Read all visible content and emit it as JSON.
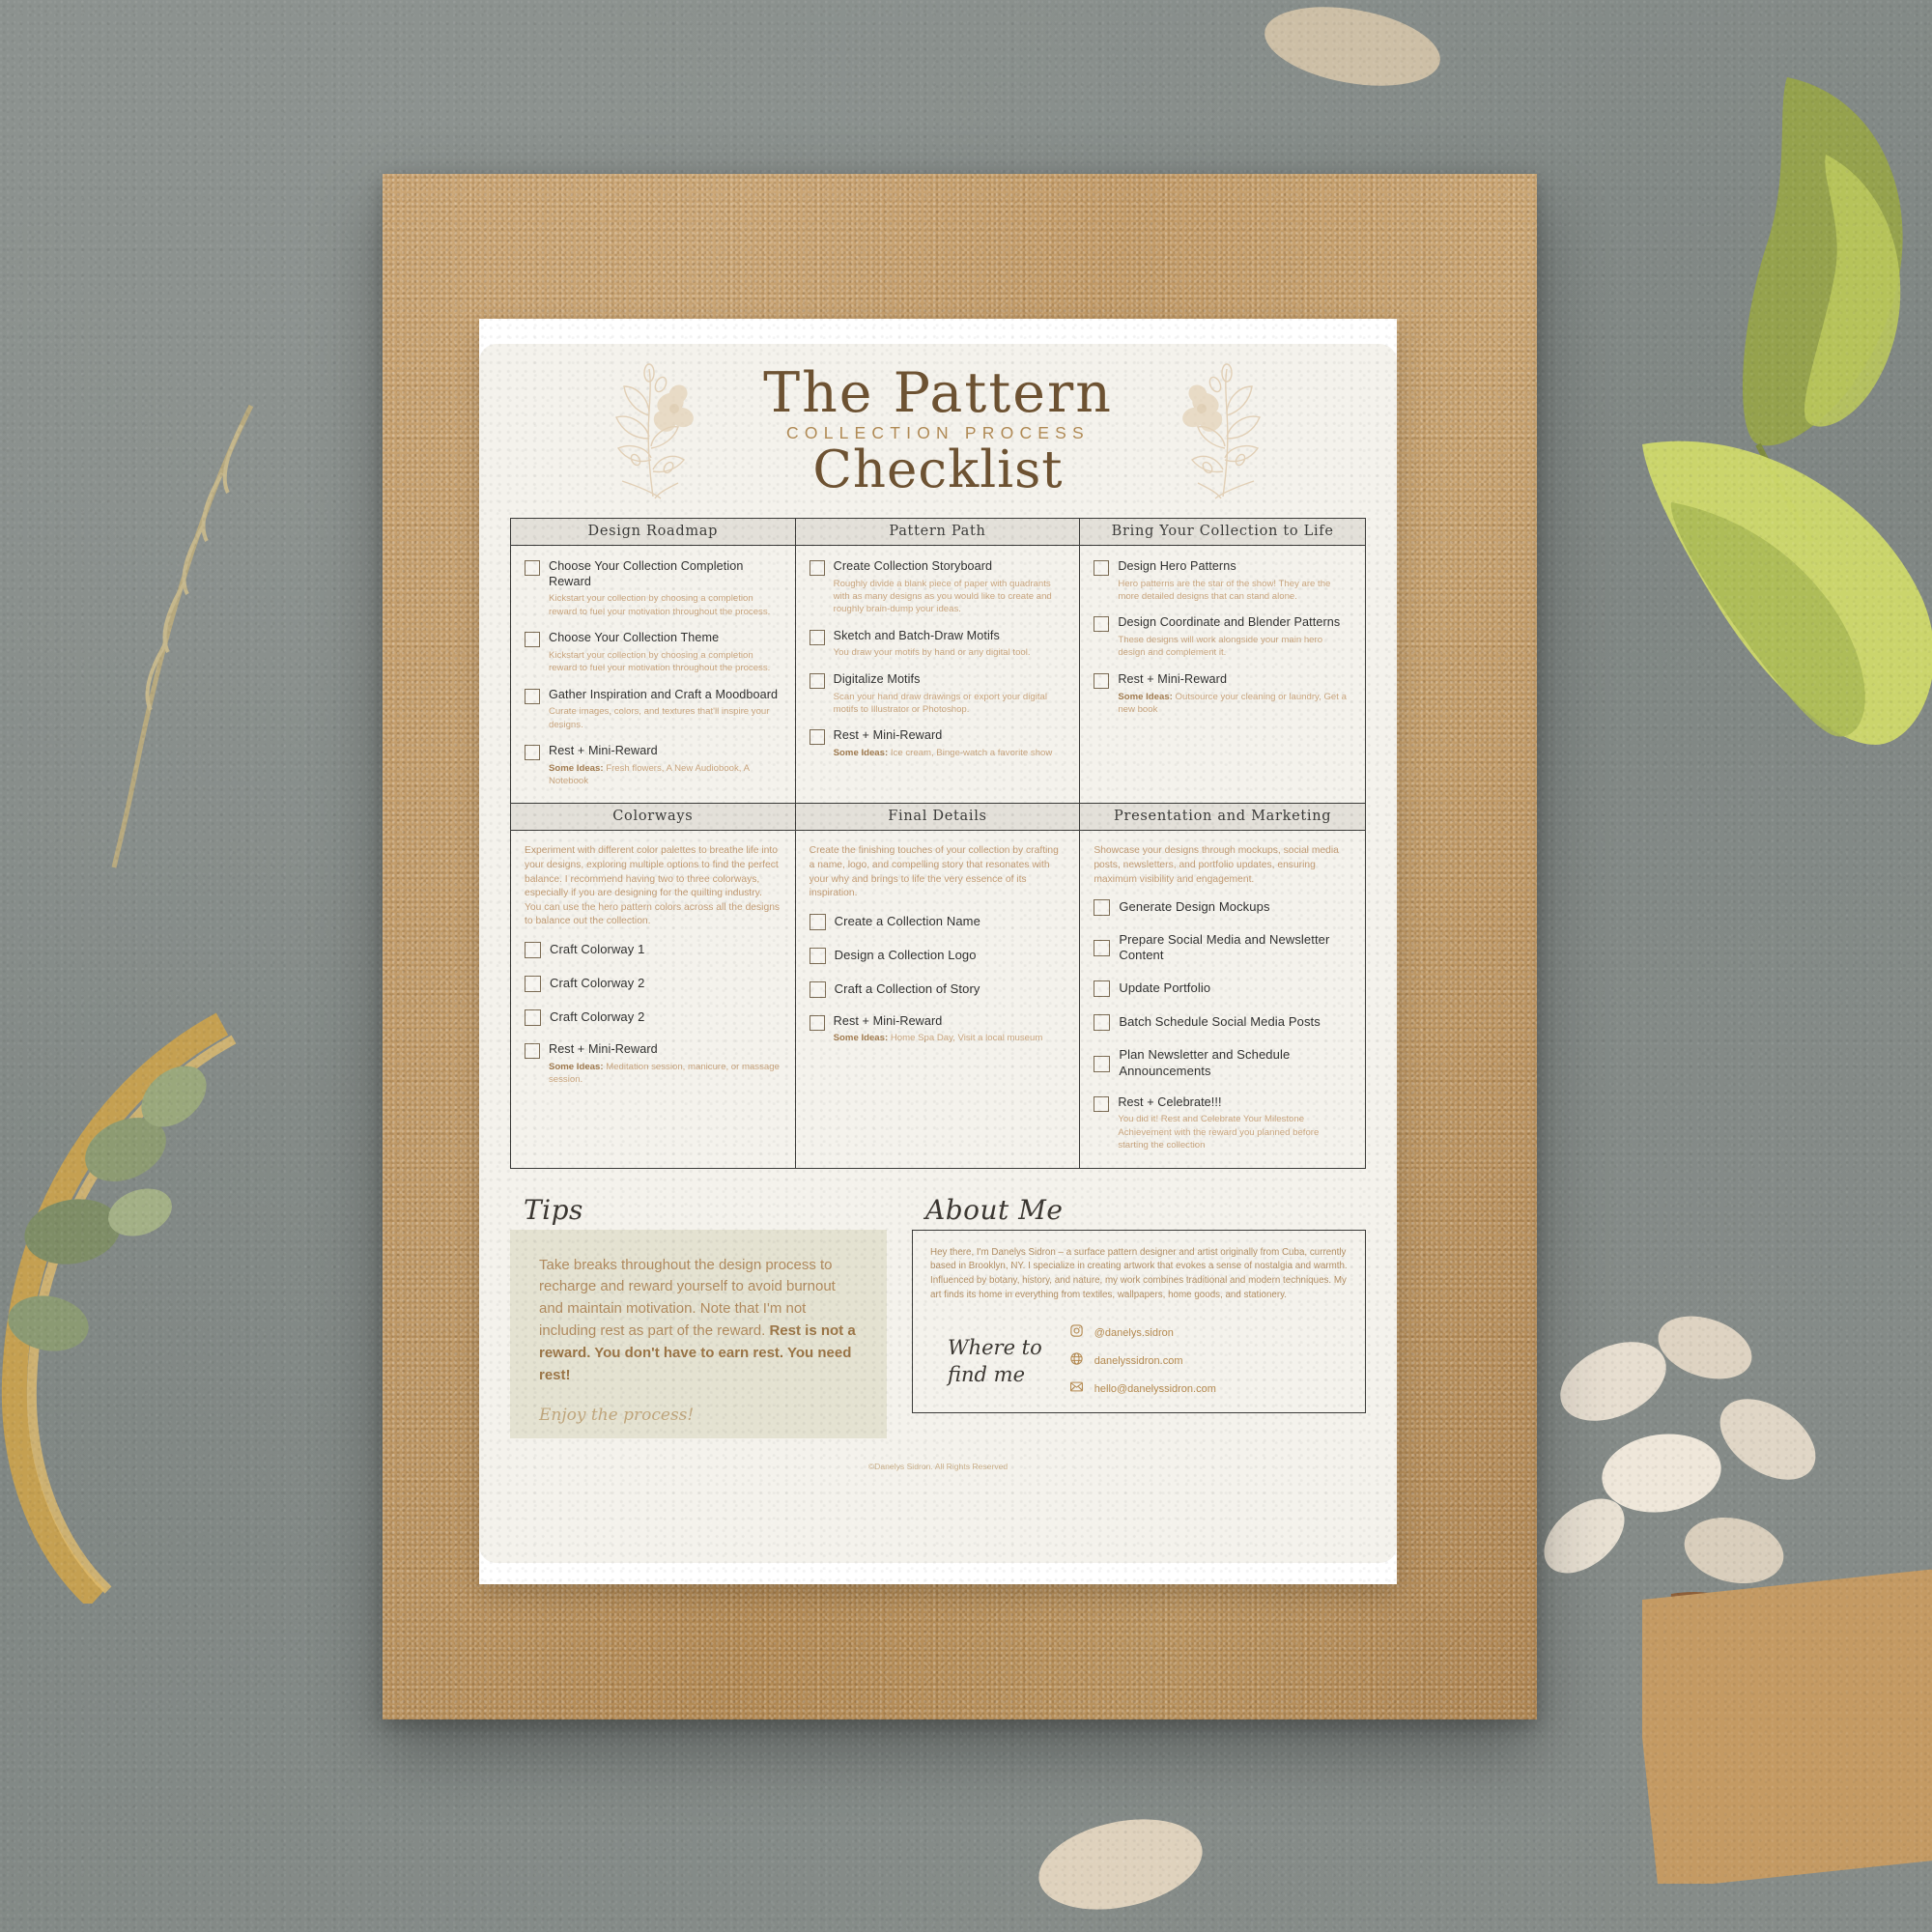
{
  "header": {
    "title_main": "The Pattern",
    "title_sub": "COLLECTION PROCESS",
    "title_script": "Checklist"
  },
  "colors": {
    "ink": "#3a3a38",
    "gold": "#b08a55",
    "tan": "#c8a47d",
    "header_fill": "#e3e0d9",
    "page_bg": "#f4f2ec",
    "tips_bg": "#e4e2d1",
    "kraft": "#c49a63",
    "backdrop": "#8b918e"
  },
  "grid": {
    "cells": [
      {
        "id": "design-roadmap",
        "heading": "Design Roadmap",
        "intro": "",
        "items": [
          {
            "title": "Choose Your Collection Completion Reward",
            "desc": "Kickstart your collection by choosing a completion reward to fuel your motivation throughout the process.",
            "lead": ""
          },
          {
            "title": "Choose Your Collection Theme",
            "desc": "Kickstart your collection by choosing a completion reward to fuel your motivation throughout the process.",
            "lead": ""
          },
          {
            "title": "Gather Inspiration and Craft a Moodboard",
            "desc": "Curate images, colors, and textures that'll inspire your designs.",
            "lead": ""
          },
          {
            "title": "Rest + Mini-Reward",
            "desc": "Fresh flowers, A New Audiobook, A Notebook",
            "lead": "Some Ideas:"
          }
        ]
      },
      {
        "id": "pattern-path",
        "heading": "Pattern Path",
        "intro": "",
        "items": [
          {
            "title": "Create Collection Storyboard",
            "desc": "Roughly divide a blank piece of paper with quadrants with as many designs as you would like to create and roughly brain-dump your ideas.",
            "lead": ""
          },
          {
            "title": "Sketch and Batch-Draw Motifs",
            "desc": "You draw your motifs by hand or any digital tool.",
            "lead": ""
          },
          {
            "title": "Digitalize Motifs",
            "desc": "Scan your hand draw drawings or export your digital motifs to Illustrator or Photoshop.",
            "lead": ""
          },
          {
            "title": "Rest + Mini-Reward",
            "desc": "Ice cream, Binge-watch a favorite show",
            "lead": "Some Ideas:"
          }
        ]
      },
      {
        "id": "bring-collection-to-life",
        "heading": "Bring Your Collection to Life",
        "intro": "",
        "items": [
          {
            "title": "Design Hero Patterns",
            "desc": "Hero patterns are the star of the show! They are the more detailed designs that can stand alone.",
            "lead": ""
          },
          {
            "title": "Design Coordinate and Blender Patterns",
            "desc": "These designs will work alongside your main hero design and complement it.",
            "lead": ""
          },
          {
            "title": "Rest + Mini-Reward",
            "desc": "Outsource your cleaning or laundry, Get a new book",
            "lead": "Some Ideas:"
          }
        ]
      },
      {
        "id": "colorways",
        "heading": "Colorways",
        "intro": "Experiment with different color palettes to breathe life into your designs, exploring multiple options to find the perfect balance. I recommend having two to three colorways, especially if you are designing for the quilting industry. You can use the hero pattern colors across all the designs to balance out the collection.",
        "items": [
          {
            "title": "Craft Colorway 1",
            "desc": "",
            "lead": ""
          },
          {
            "title": "Craft Colorway 2",
            "desc": "",
            "lead": ""
          },
          {
            "title": "Craft Colorway 2",
            "desc": "",
            "lead": ""
          },
          {
            "title": "Rest + Mini-Reward",
            "desc": "Meditation session, manicure, or massage session.",
            "lead": "Some Ideas:"
          }
        ]
      },
      {
        "id": "final-details",
        "heading": "Final Details",
        "intro": "Create the finishing touches of your collection by crafting a name, logo, and compelling story that resonates with your why and brings to life the very essence of its inspiration.",
        "items": [
          {
            "title": "Create a Collection Name",
            "desc": "",
            "lead": ""
          },
          {
            "title": "Design a Collection Logo",
            "desc": "",
            "lead": ""
          },
          {
            "title": "Craft a Collection of Story",
            "desc": "",
            "lead": ""
          },
          {
            "title": "Rest + Mini-Reward",
            "desc": "Home Spa Day, Visit a local museum",
            "lead": "Some Ideas:"
          }
        ]
      },
      {
        "id": "presentation-and-marketing",
        "heading": "Presentation and Marketing",
        "intro": "Showcase your designs through mockups, social media posts, newsletters, and portfolio updates, ensuring maximum visibility and engagement.",
        "items": [
          {
            "title": "Generate Design Mockups",
            "desc": "",
            "lead": ""
          },
          {
            "title": "Prepare Social Media and Newsletter Content",
            "desc": "",
            "lead": ""
          },
          {
            "title": "Update Portfolio",
            "desc": "",
            "lead": ""
          },
          {
            "title": "Batch Schedule Social Media Posts",
            "desc": "",
            "lead": ""
          },
          {
            "title": "Plan Newsletter and Schedule Announcements",
            "desc": "",
            "lead": ""
          },
          {
            "title": "Rest + Celebrate!!!",
            "desc": "You did it! Rest and Celebrate Your Milestone Achievement with the reward you planned before starting the collection",
            "lead": ""
          }
        ]
      }
    ]
  },
  "tips": {
    "label": "Tips",
    "body_plain": "Take breaks throughout the design process to recharge and reward yourself to avoid burnout and maintain motivation. Note that I'm not including rest as part of the reward. ",
    "body_bold": "Rest is not a reward. You don't have to earn rest. You need rest!",
    "sign_off": "Enjoy the process!"
  },
  "about": {
    "label": "About Me",
    "body": "Hey there, I'm Danelys Sidron – a surface pattern designer and artist originally from Cuba, currently based in Brooklyn, NY. I specialize in creating artwork that evokes a sense of nostalgia and warmth. Influenced by botany, history, and nature, my work combines traditional and modern techniques. My art finds its home in everything from textiles, wallpapers, home goods, and stationery.",
    "find_me_label": "Where to\nfind me",
    "contacts": [
      {
        "icon": "instagram-icon",
        "value": "@danelys.sidron"
      },
      {
        "icon": "globe-icon",
        "value": "danelyssidron.com"
      },
      {
        "icon": "envelope-icon",
        "value": "hello@danelyssidron.com"
      }
    ]
  },
  "footer": {
    "copyright": "©Danelys Sidron. All Rights Reserved"
  }
}
